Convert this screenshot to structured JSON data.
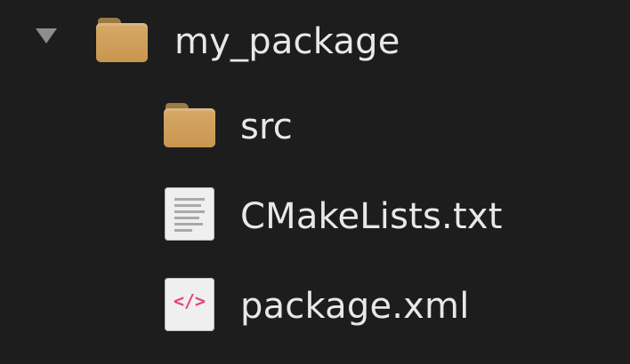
{
  "tree": {
    "root": {
      "label": "my_package",
      "icon": "folder-icon",
      "expanded": true
    },
    "children": [
      {
        "label": "src",
        "icon": "folder-icon"
      },
      {
        "label": "CMakeLists.txt",
        "icon": "text-file-icon"
      },
      {
        "label": "package.xml",
        "icon": "xml-file-icon",
        "glyph": "</>"
      }
    ]
  },
  "colors": {
    "background": "#1d1d1d",
    "text": "#e8e8e8",
    "folder": "#d6a867",
    "xml_accent": "#e0457a"
  }
}
